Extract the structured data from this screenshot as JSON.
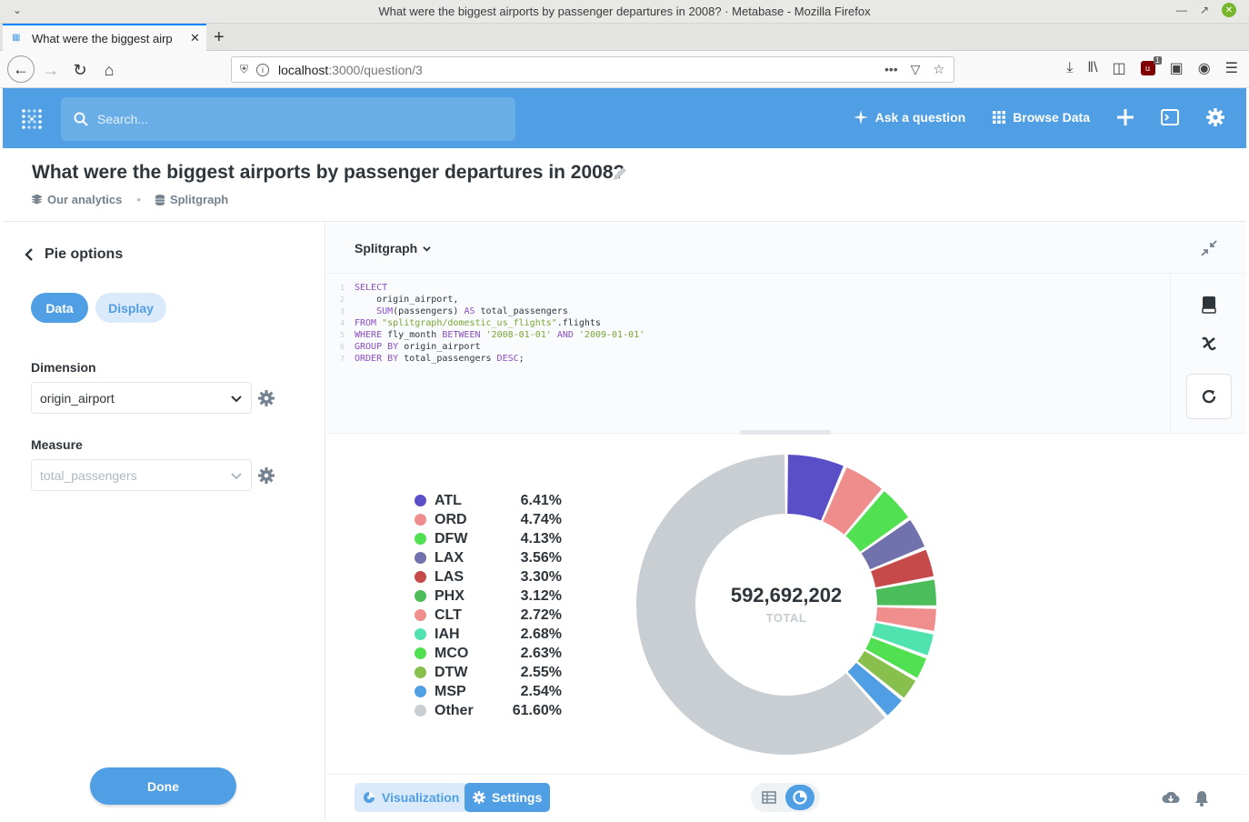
{
  "browser": {
    "window_title": "What were the biggest airports by passenger departures in 2008? · Metabase - Mozilla Firefox",
    "tab_title": "What were the biggest airp",
    "url_host": "localhost",
    "url_path": ":3000/question/3",
    "ublock_count": "1"
  },
  "nav": {
    "search_placeholder": "Search...",
    "ask_question": "Ask a question",
    "browse_data": "Browse Data"
  },
  "question": {
    "title": "What were the biggest airports by passenger departures in 2008?",
    "collection": "Our analytics",
    "database": "Splitgraph"
  },
  "sidebar": {
    "title": "Pie options",
    "tab_data": "Data",
    "tab_display": "Display",
    "dimension_label": "Dimension",
    "dimension_value": "origin_airport",
    "measure_label": "Measure",
    "measure_value": "total_passengers",
    "done": "Done"
  },
  "editor": {
    "database": "Splitgraph",
    "lines": [
      {
        "n": "1",
        "parts": [
          {
            "t": "SELECT",
            "c": "kw"
          }
        ]
      },
      {
        "n": "2",
        "parts": [
          {
            "t": "    origin_airport,",
            "c": ""
          }
        ]
      },
      {
        "n": "3",
        "parts": [
          {
            "t": "    ",
            "c": ""
          },
          {
            "t": "SUM",
            "c": "kw"
          },
          {
            "t": "(passengers) ",
            "c": ""
          },
          {
            "t": "AS",
            "c": "kw"
          },
          {
            "t": " total_passengers",
            "c": ""
          }
        ]
      },
      {
        "n": "4",
        "parts": [
          {
            "t": "FROM",
            "c": "kw"
          },
          {
            "t": " ",
            "c": ""
          },
          {
            "t": "\"splitgraph/domestic_us_flights\"",
            "c": "str"
          },
          {
            "t": ".flights",
            "c": ""
          }
        ]
      },
      {
        "n": "5",
        "parts": [
          {
            "t": "WHERE",
            "c": "kw"
          },
          {
            "t": " fly_month ",
            "c": ""
          },
          {
            "t": "BETWEEN",
            "c": "kw"
          },
          {
            "t": " ",
            "c": ""
          },
          {
            "t": "'2008-01-01'",
            "c": "str"
          },
          {
            "t": " ",
            "c": ""
          },
          {
            "t": "AND",
            "c": "kw"
          },
          {
            "t": " ",
            "c": ""
          },
          {
            "t": "'2009-01-01'",
            "c": "str"
          }
        ]
      },
      {
        "n": "6",
        "parts": [
          {
            "t": "GROUP BY",
            "c": "kw"
          },
          {
            "t": " origin_airport",
            "c": ""
          }
        ]
      },
      {
        "n": "7",
        "parts": [
          {
            "t": "ORDER BY",
            "c": "kw"
          },
          {
            "t": " total_passengers ",
            "c": ""
          },
          {
            "t": "DESC",
            "c": "kw"
          },
          {
            "t": ";",
            "c": ""
          }
        ]
      }
    ]
  },
  "chart_data": {
    "type": "pie",
    "total": "592,692,202",
    "total_label": "TOTAL",
    "slices": [
      {
        "label": "ATL",
        "pct": "6.41%",
        "value": 6.41,
        "color": "#5b4fc8"
      },
      {
        "label": "ORD",
        "pct": "4.74%",
        "value": 4.74,
        "color": "#ef8c8c"
      },
      {
        "label": "DFW",
        "pct": "4.13%",
        "value": 4.13,
        "color": "#51e051"
      },
      {
        "label": "LAX",
        "pct": "3.56%",
        "value": 3.56,
        "color": "#7172ad"
      },
      {
        "label": "LAS",
        "pct": "3.30%",
        "value": 3.3,
        "color": "#c74a4a"
      },
      {
        "label": "PHX",
        "pct": "3.12%",
        "value": 3.12,
        "color": "#4cbd5b"
      },
      {
        "label": "CLT",
        "pct": "2.72%",
        "value": 2.72,
        "color": "#f08d8d"
      },
      {
        "label": "IAH",
        "pct": "2.68%",
        "value": 2.68,
        "color": "#50e3b0"
      },
      {
        "label": "MCO",
        "pct": "2.63%",
        "value": 2.63,
        "color": "#51e051"
      },
      {
        "label": "DTW",
        "pct": "2.55%",
        "value": 2.55,
        "color": "#88bf4d"
      },
      {
        "label": "MSP",
        "pct": "2.54%",
        "value": 2.54,
        "color": "#509ee3"
      },
      {
        "label": "Other",
        "pct": "61.60%",
        "value": 61.6,
        "color": "#c9ced3"
      }
    ]
  },
  "footer": {
    "visualization": "Visualization",
    "settings": "Settings"
  },
  "colors": {
    "brand": "#509ee3",
    "text": "#2e353b",
    "muted": "#74838f"
  }
}
